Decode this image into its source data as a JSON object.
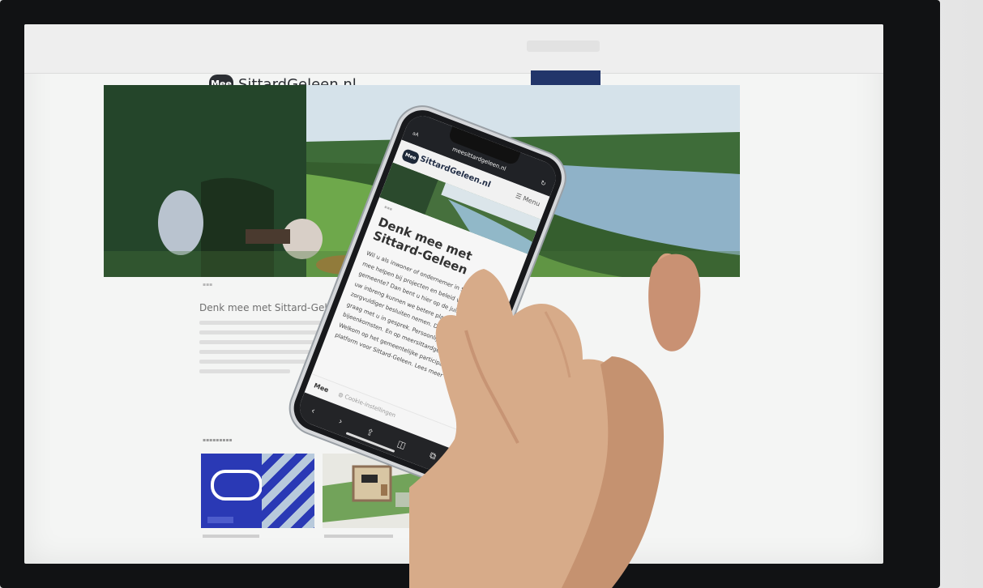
{
  "monitor": {
    "site_logo_label": "Mee",
    "site_name": "SittardGeleen.nl",
    "section_heading": "Denk mee met Sittard-Geleen"
  },
  "phone": {
    "url": "meesittardgeleen.nl",
    "logo_label": "Mee",
    "site_name": "SittardGeleen.nl",
    "menu_label": "Menu",
    "title": "Denk mee met Sittard-Geleen",
    "paragraph": "Wil u als inwoner of ondernemer in Sittard-Geleen mee helpen bij projecten en beleid van de gemeente? Dan bent u hier op de juiste plek. Met uw inbreng kunnen we betere plannen maken en zorgvuldiger besluiten nemen. Daarom gaan we graag met u in gesprek. Persoonlijk, tijdens bijeenkomsten. En op meersittardgeleen.nl. Welkom op het gemeentelijke participatie-platform voor Sittard-Geleen. Lees meer",
    "bottom_label": "Mee",
    "cookie_label": "Cookie-instellingen"
  }
}
